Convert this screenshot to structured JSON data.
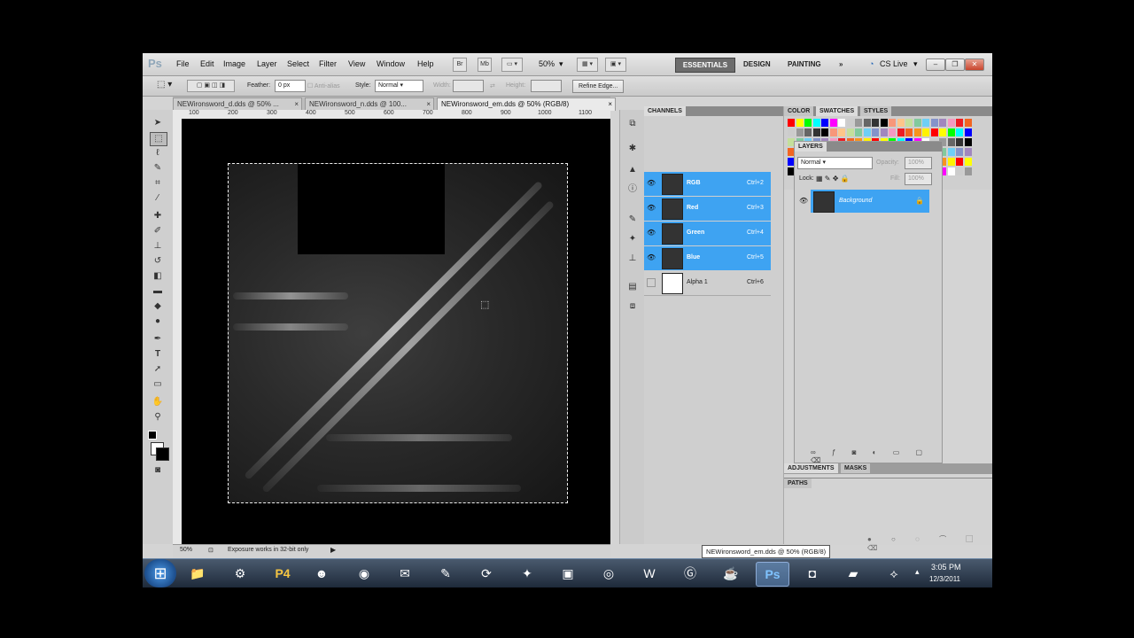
{
  "app": {
    "logo": "Ps",
    "menu": [
      "File",
      "Edit",
      "Image",
      "Layer",
      "Select",
      "Filter",
      "View",
      "Window",
      "Help"
    ],
    "mini_buttons": [
      "Br",
      "Mb"
    ],
    "zoom": "50%",
    "workspaces": [
      "ESSENTIALS",
      "DESIGN",
      "PAINTING",
      "»"
    ],
    "cslive": "CS Live",
    "window_controls": [
      "–",
      "❐",
      "✕"
    ]
  },
  "options": {
    "feather_label": "Feather:",
    "feather_value": "0 px",
    "antialias_label": "Anti-alias",
    "style_label": "Style:",
    "style_value": "Normal",
    "width_label": "Width:",
    "height_label": "Height:",
    "refine_edge": "Refine Edge..."
  },
  "tabs": [
    {
      "label": "NEWironsword_d.dds @ 50% ...",
      "close": "×"
    },
    {
      "label": "NEWironsword_n.dds @ 100...",
      "close": "×"
    },
    {
      "label": "NEWironsword_em.dds @ 50% (RGB/8)",
      "close": "×"
    }
  ],
  "ruler": [
    "100",
    "200",
    "300",
    "400",
    "500",
    "600",
    "700",
    "800",
    "900",
    "1000",
    "1100"
  ],
  "status": {
    "zoom": "50%",
    "text": "Exposure works in 32-bit only"
  },
  "channels": {
    "tab": "CHANNELS",
    "rows": [
      {
        "name": "RGB",
        "key": "Ctrl+2"
      },
      {
        "name": "Red",
        "key": "Ctrl+3"
      },
      {
        "name": "Green",
        "key": "Ctrl+4"
      },
      {
        "name": "Blue",
        "key": "Ctrl+5"
      },
      {
        "name": "Alpha 1",
        "key": "Ctrl+6"
      }
    ]
  },
  "swatches": {
    "tabs": [
      "COLOR",
      "SWATCHES",
      "STYLES"
    ]
  },
  "layers": {
    "tab": "LAYERS",
    "blend": "Normal",
    "opacity_label": "Opacity:",
    "opacity": "100%",
    "lock_label": "Lock:",
    "fill_label": "Fill:",
    "fill": "100%",
    "layer_name": "Background"
  },
  "adjust": {
    "tabs": [
      "ADJUSTMENTS",
      "MASKS"
    ]
  },
  "paths": {
    "tab": "PATHS"
  },
  "tooltip": "NEWironsword_em.dds @ 50% (RGB/8)",
  "taskbar": {
    "time": "3:05 PM",
    "date": "12/3/2011"
  }
}
